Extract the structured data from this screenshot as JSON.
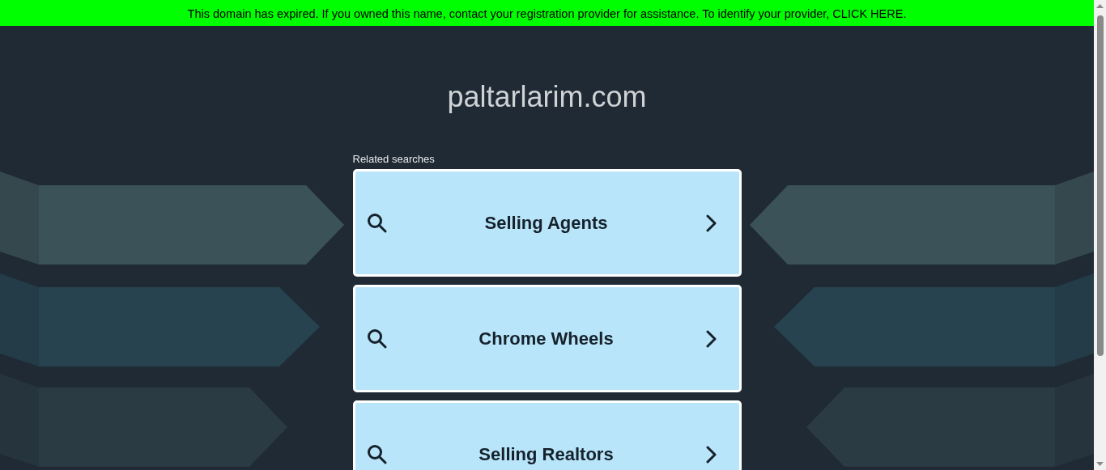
{
  "banner": {
    "text": "This domain has expired. If you owned this name, contact your registration provider for assistance. To identify your provider, CLICK HERE."
  },
  "title": "paltarlarim.com",
  "related_label": "Related searches",
  "searches": [
    {
      "label": "Selling Agents"
    },
    {
      "label": "Chrome Wheels"
    },
    {
      "label": "Selling Realtors"
    }
  ]
}
